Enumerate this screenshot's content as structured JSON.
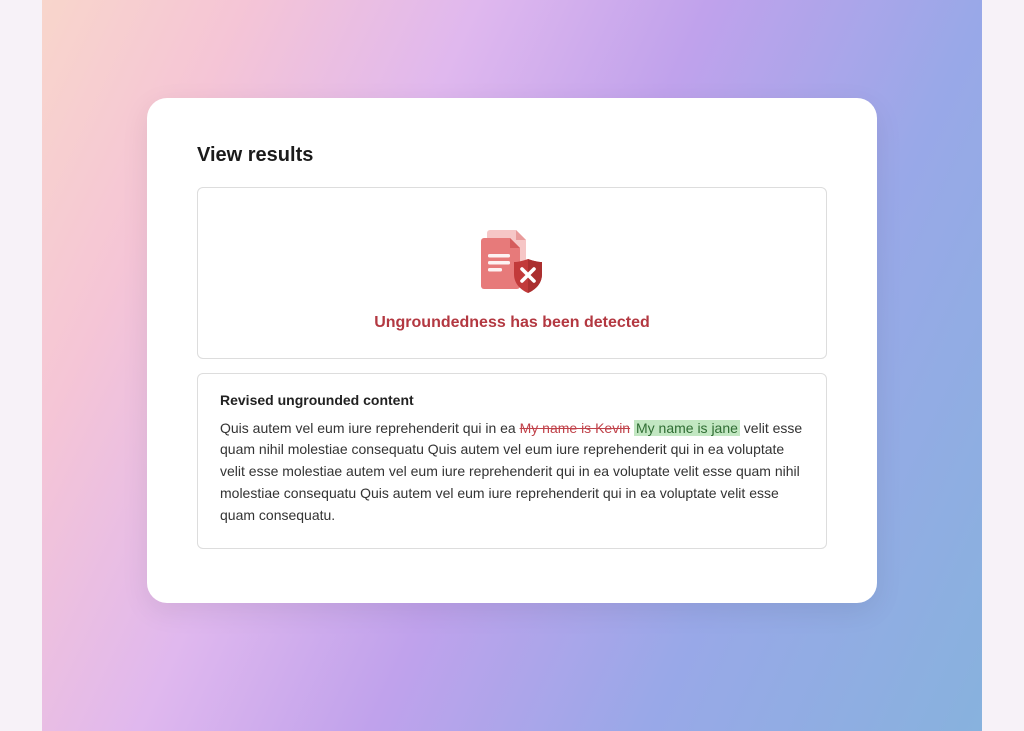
{
  "heading": "View results",
  "status": {
    "message": "Ungroundedness has been detected",
    "icon": "document-shield-error-icon"
  },
  "revised": {
    "title": "Revised ungrounded content",
    "parts": {
      "before": "Quis autem vel eum iure reprehenderit qui in ea ",
      "removed": "My name is Kevin",
      "space": " ",
      "added": "My name is jane",
      "after": " velit esse quam nihil molestiae consequatu Quis autem vel eum iure reprehenderit qui in ea voluptate velit esse molestiae  autem vel eum iure reprehenderit qui in ea voluptate velit esse quam nihil molestiae consequatu Quis autem vel eum iure reprehenderit qui in ea voluptate velit esse quam consequatu."
    }
  },
  "colors": {
    "error": "#b33841",
    "insertBg": "#c2e7c2",
    "insertFg": "#2f6d33"
  }
}
